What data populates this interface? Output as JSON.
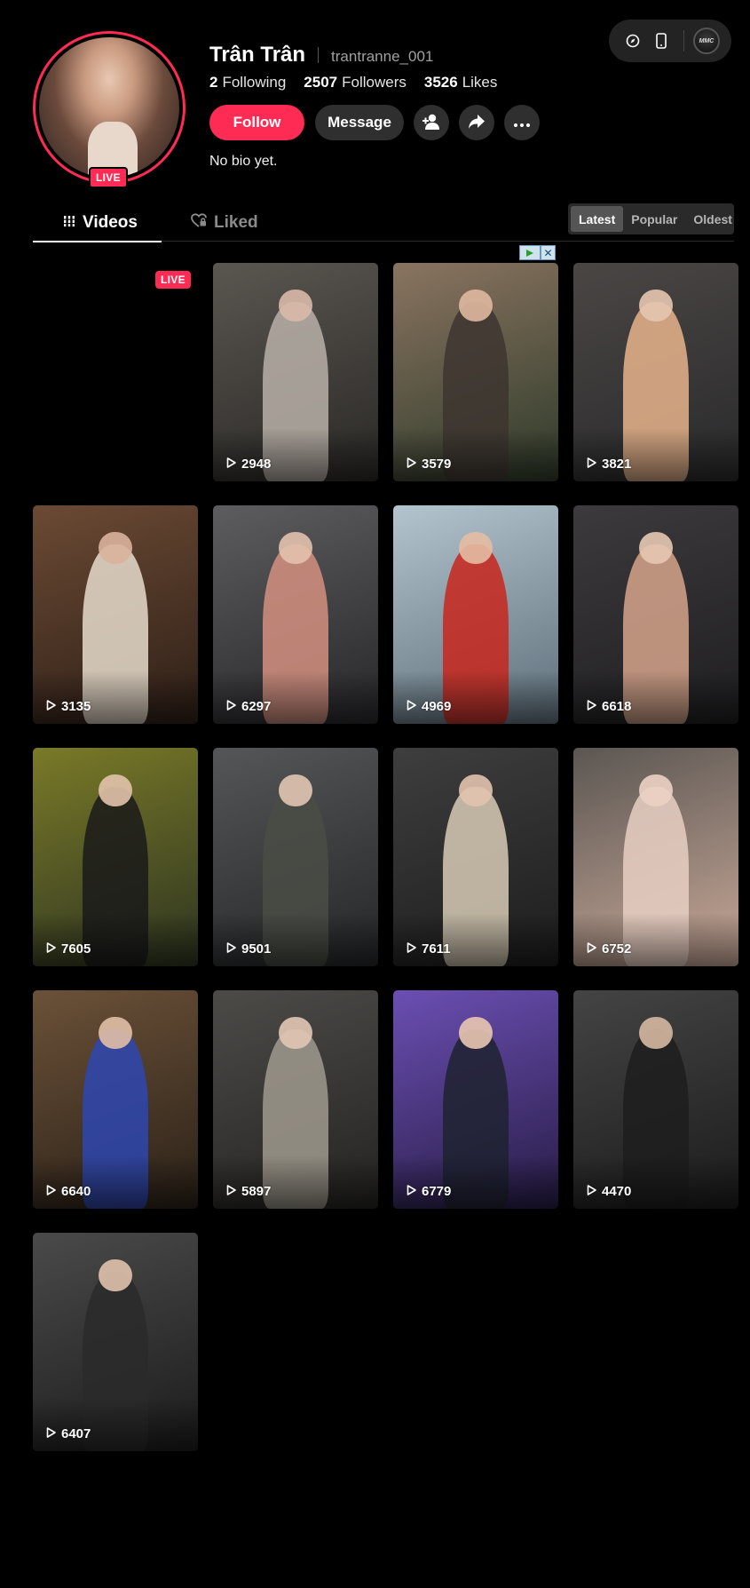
{
  "toolbar": {
    "icons": [
      "compass-icon",
      "phone-icon"
    ],
    "avatar_label": "MMC"
  },
  "profile": {
    "display_name": "Trân Trân",
    "username": "trantranne_001",
    "live_label": "LIVE",
    "stats": [
      {
        "value": "2",
        "label": "Following"
      },
      {
        "value": "2507",
        "label": "Followers"
      },
      {
        "value": "3526",
        "label": "Likes"
      }
    ],
    "bio": "No bio yet."
  },
  "actions": {
    "follow_label": "Follow",
    "message_label": "Message",
    "icons": [
      "add-friend-icon",
      "share-icon",
      "more-icon"
    ]
  },
  "tabs": {
    "videos_label": "Videos",
    "liked_label": "Liked"
  },
  "sort": {
    "options": [
      "Latest",
      "Popular",
      "Oldest"
    ],
    "selected": "Latest"
  },
  "grid": {
    "live_label": "LIVE",
    "videos": [
      {
        "views": "2948"
      },
      {
        "views": "3579"
      },
      {
        "views": "3821"
      },
      {
        "views": "3135"
      },
      {
        "views": "6297"
      },
      {
        "views": "4969"
      },
      {
        "views": "6618"
      },
      {
        "views": "7605"
      },
      {
        "views": "9501"
      },
      {
        "views": "7611"
      },
      {
        "views": "6752"
      },
      {
        "views": "6640"
      },
      {
        "views": "5897"
      },
      {
        "views": "6779"
      },
      {
        "views": "4470"
      },
      {
        "views": "6407"
      }
    ]
  },
  "colors": {
    "accent": "#fe2c55",
    "background": "#000000",
    "button_dark": "#2f2f2f"
  }
}
